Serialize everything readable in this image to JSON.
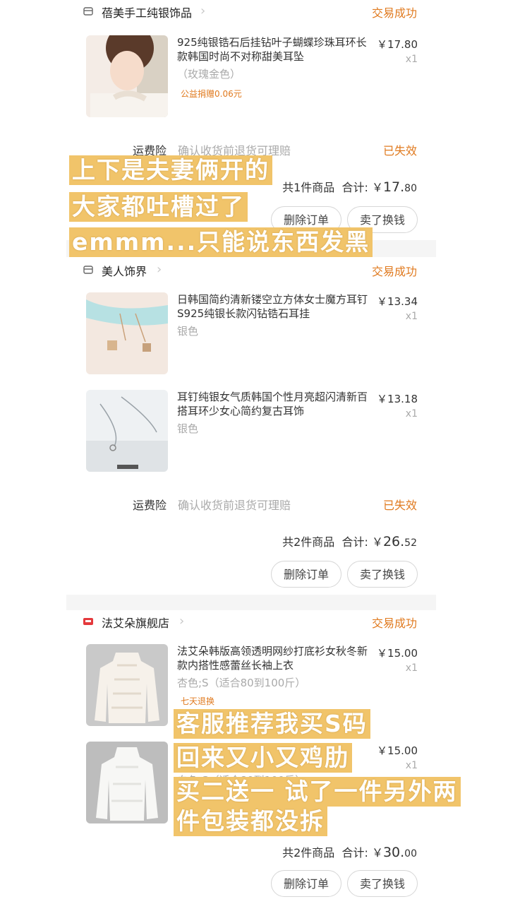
{
  "orders": [
    {
      "shop": "蓓美手工纯银饰品",
      "status": "交易成功",
      "items": [
        {
          "title": "925纯银锆石后挂钻叶子蝴蝶珍珠耳环长款韩国时尚不对称甜美耳坠",
          "spec": "（玫瑰金色）",
          "badge": "公益捐赠0.06元",
          "price": "￥17.80",
          "qty": "x1"
        }
      ],
      "insurance": {
        "label": "运费险",
        "desc": "确认收货前退货可理赔",
        "status": "已失效"
      },
      "summary": {
        "count": "共1件商品",
        "total_label": "合计:",
        "total_currency": "￥",
        "total_int": "17.",
        "total_dec": "80"
      },
      "buttons": {
        "delete": "删除订单",
        "resell": "卖了换钱"
      }
    },
    {
      "shop": "美人饰界",
      "status": "交易成功",
      "items": [
        {
          "title": "日韩国简约清新镂空立方体女士魔方耳钉S925纯银长款闪钻锆石耳挂",
          "spec": "银色",
          "price": "￥13.34",
          "qty": "x1"
        },
        {
          "title": "耳钉纯银女气质韩国个性月亮超闪清新百搭耳环少女心简约复古耳饰",
          "spec": "银色",
          "price": "￥13.18",
          "qty": "x1"
        }
      ],
      "insurance": {
        "label": "运费险",
        "desc": "确认收货前退货可理赔",
        "status": "已失效"
      },
      "summary": {
        "count": "共2件商品",
        "total_label": "合计:",
        "total_currency": "￥",
        "total_int": "26.",
        "total_dec": "52"
      },
      "buttons": {
        "delete": "删除订单",
        "resell": "卖了换钱"
      }
    },
    {
      "shop": "法艾朵旗舰店",
      "status": "交易成功",
      "items": [
        {
          "title": "法艾朵韩版高领透明网纱打底衫女秋冬新款内搭性感蕾丝长袖上衣",
          "spec": "杏色;S（适合80到100斤）",
          "badge": "七天退换",
          "price": "￥15.00",
          "qty": "x1"
        },
        {
          "title": "",
          "spec": "白色;S（适合80到100斤）",
          "price": "￥15.00",
          "qty": "x1"
        }
      ],
      "summary": {
        "count": "共2件商品",
        "total_label": "合计:",
        "total_currency": "￥",
        "total_int": "30.",
        "total_dec": "00"
      },
      "buttons": {
        "delete": "删除订单",
        "resell": "卖了换钱"
      }
    }
  ],
  "captions": {
    "top": [
      "上下是夫妻俩开的",
      "大家都吐槽过了",
      "emmm...只能说东西发黑"
    ],
    "bottom": [
      "客服推荐我买S码",
      "回来又小又鸡肋",
      "买二送一  试了一件另外两",
      "件包装都没拆"
    ]
  },
  "colors": {
    "accent": "#e07a1f",
    "caption_bg": "#f1c46a",
    "tmall_red": "#e4393c"
  }
}
